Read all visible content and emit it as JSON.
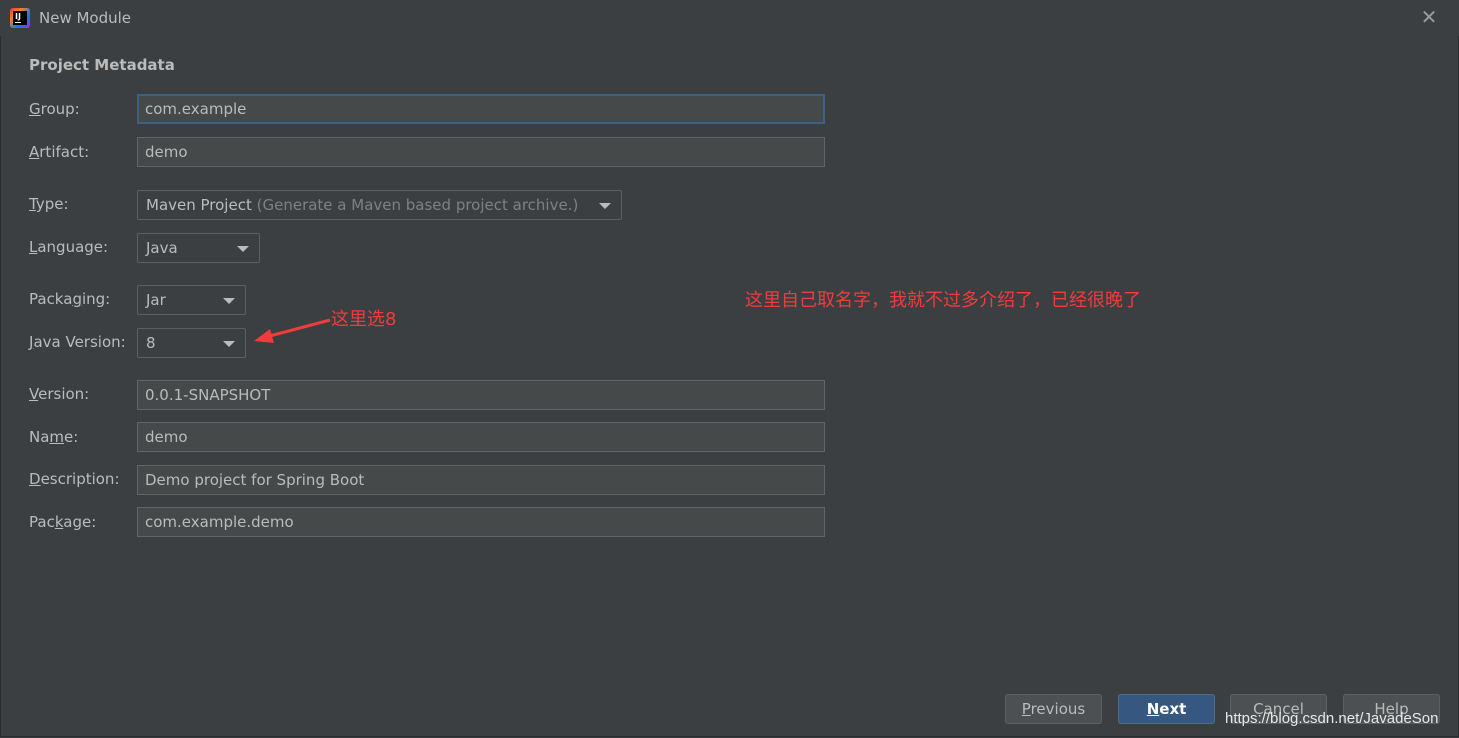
{
  "window": {
    "title": "New Module",
    "app_icon_text": "IJ"
  },
  "section": {
    "title": "Project Metadata"
  },
  "form": {
    "group": {
      "label_key": "G",
      "label_rest": "roup:",
      "value": "com.example"
    },
    "artifact": {
      "label_key": "A",
      "label_rest": "rtifact:",
      "value": "demo"
    },
    "type": {
      "label_key": "T",
      "label_rest": "ype:",
      "value": "Maven Project",
      "hint": "(Generate a Maven based project archive.)"
    },
    "language": {
      "label_key": "L",
      "label_rest": "anguage:",
      "value": "Java"
    },
    "packaging": {
      "label_pre": "Packa",
      "label_key": "g",
      "label_rest": "ing:",
      "value": "Jar"
    },
    "java_version": {
      "label_key": "J",
      "label_rest": "ava Version:",
      "value": "8"
    },
    "version": {
      "label_key": "V",
      "label_rest": "ersion:",
      "value": "0.0.1-SNAPSHOT"
    },
    "name": {
      "label_pre": "Na",
      "label_key": "m",
      "label_rest": "e:",
      "value": "demo"
    },
    "description": {
      "label_key": "D",
      "label_rest": "escription:",
      "value": "Demo project for Spring Boot"
    },
    "package": {
      "label_pre": "Pac",
      "label_key": "k",
      "label_rest": "age:",
      "value": "com.example.demo"
    }
  },
  "annotations": {
    "java_note": "这里选8",
    "name_note": "这里自己取名字，我就不过多介绍了，已经很晚了",
    "color": "#f03c3c"
  },
  "buttons": {
    "previous_key": "P",
    "previous_rest": "revious",
    "next_key": "N",
    "next_rest": "ext",
    "cancel": "Cancel",
    "help": "Help"
  },
  "watermark": "https://blog.csdn.net/JavadeSon",
  "colors": {
    "background": "#3c3f41",
    "field": "#45494a",
    "focus_border": "#3d6185",
    "primary_button": "#365880"
  }
}
